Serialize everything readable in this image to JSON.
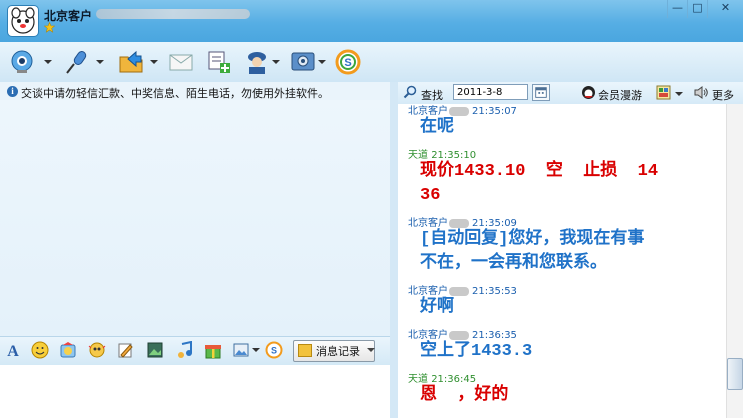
{
  "window": {
    "title": "北京客户",
    "controls": [
      "—",
      "□",
      "✕"
    ]
  },
  "toolbar": {
    "icons": [
      "video-call-icon",
      "voice-call-icon",
      "send-file-icon",
      "mail-icon",
      "add-app-icon",
      "remote-assist-icon",
      "settings-icon",
      "soso-icon"
    ]
  },
  "notice": {
    "text": "交谈中请勿轻信汇款、中奖信息、陌生电话，勿使用外挂软件。"
  },
  "input_toolbar": {
    "icons": [
      "font-icon",
      "emoticon-icon",
      "magic-face-icon",
      "shake-icon",
      "scrawl-icon",
      "screenshot-icon",
      "music-icon",
      "gift-icon",
      "image-icon",
      "soso-icon"
    ],
    "message_log_label": "消息记录"
  },
  "history_bar": {
    "search_label": "查找",
    "date_value": "2011-3-8",
    "vip_label": "会员漫游",
    "more_label": "更多"
  },
  "colors": {
    "contact_header": "#1b5fae",
    "self_header": "#2f8f2f",
    "contact_text": "#1f72c8",
    "self_text": "#d90000"
  },
  "messages": [
    {
      "sender": "北京客户",
      "time": "21:35:07",
      "type": "contact",
      "lines": [
        "在呢"
      ]
    },
    {
      "sender": "天道",
      "time": "21:35:10",
      "type": "self",
      "lines": [
        "现价1433.10  空  止损  14",
        "36"
      ]
    },
    {
      "sender": "北京客户",
      "time": "21:35:09",
      "type": "contact",
      "lines": [
        "[自动回复]您好，我现在有事",
        "不在，一会再和您联系。"
      ]
    },
    {
      "sender": "北京客户",
      "time": "21:35:53",
      "type": "contact",
      "lines": [
        "好啊"
      ]
    },
    {
      "sender": "北京客户",
      "time": "21:36:35",
      "type": "contact",
      "lines": [
        "空上了1433.3"
      ]
    },
    {
      "sender": "天道",
      "time": "21:36:45",
      "type": "self",
      "lines": [
        "恩  ，好的"
      ]
    }
  ]
}
